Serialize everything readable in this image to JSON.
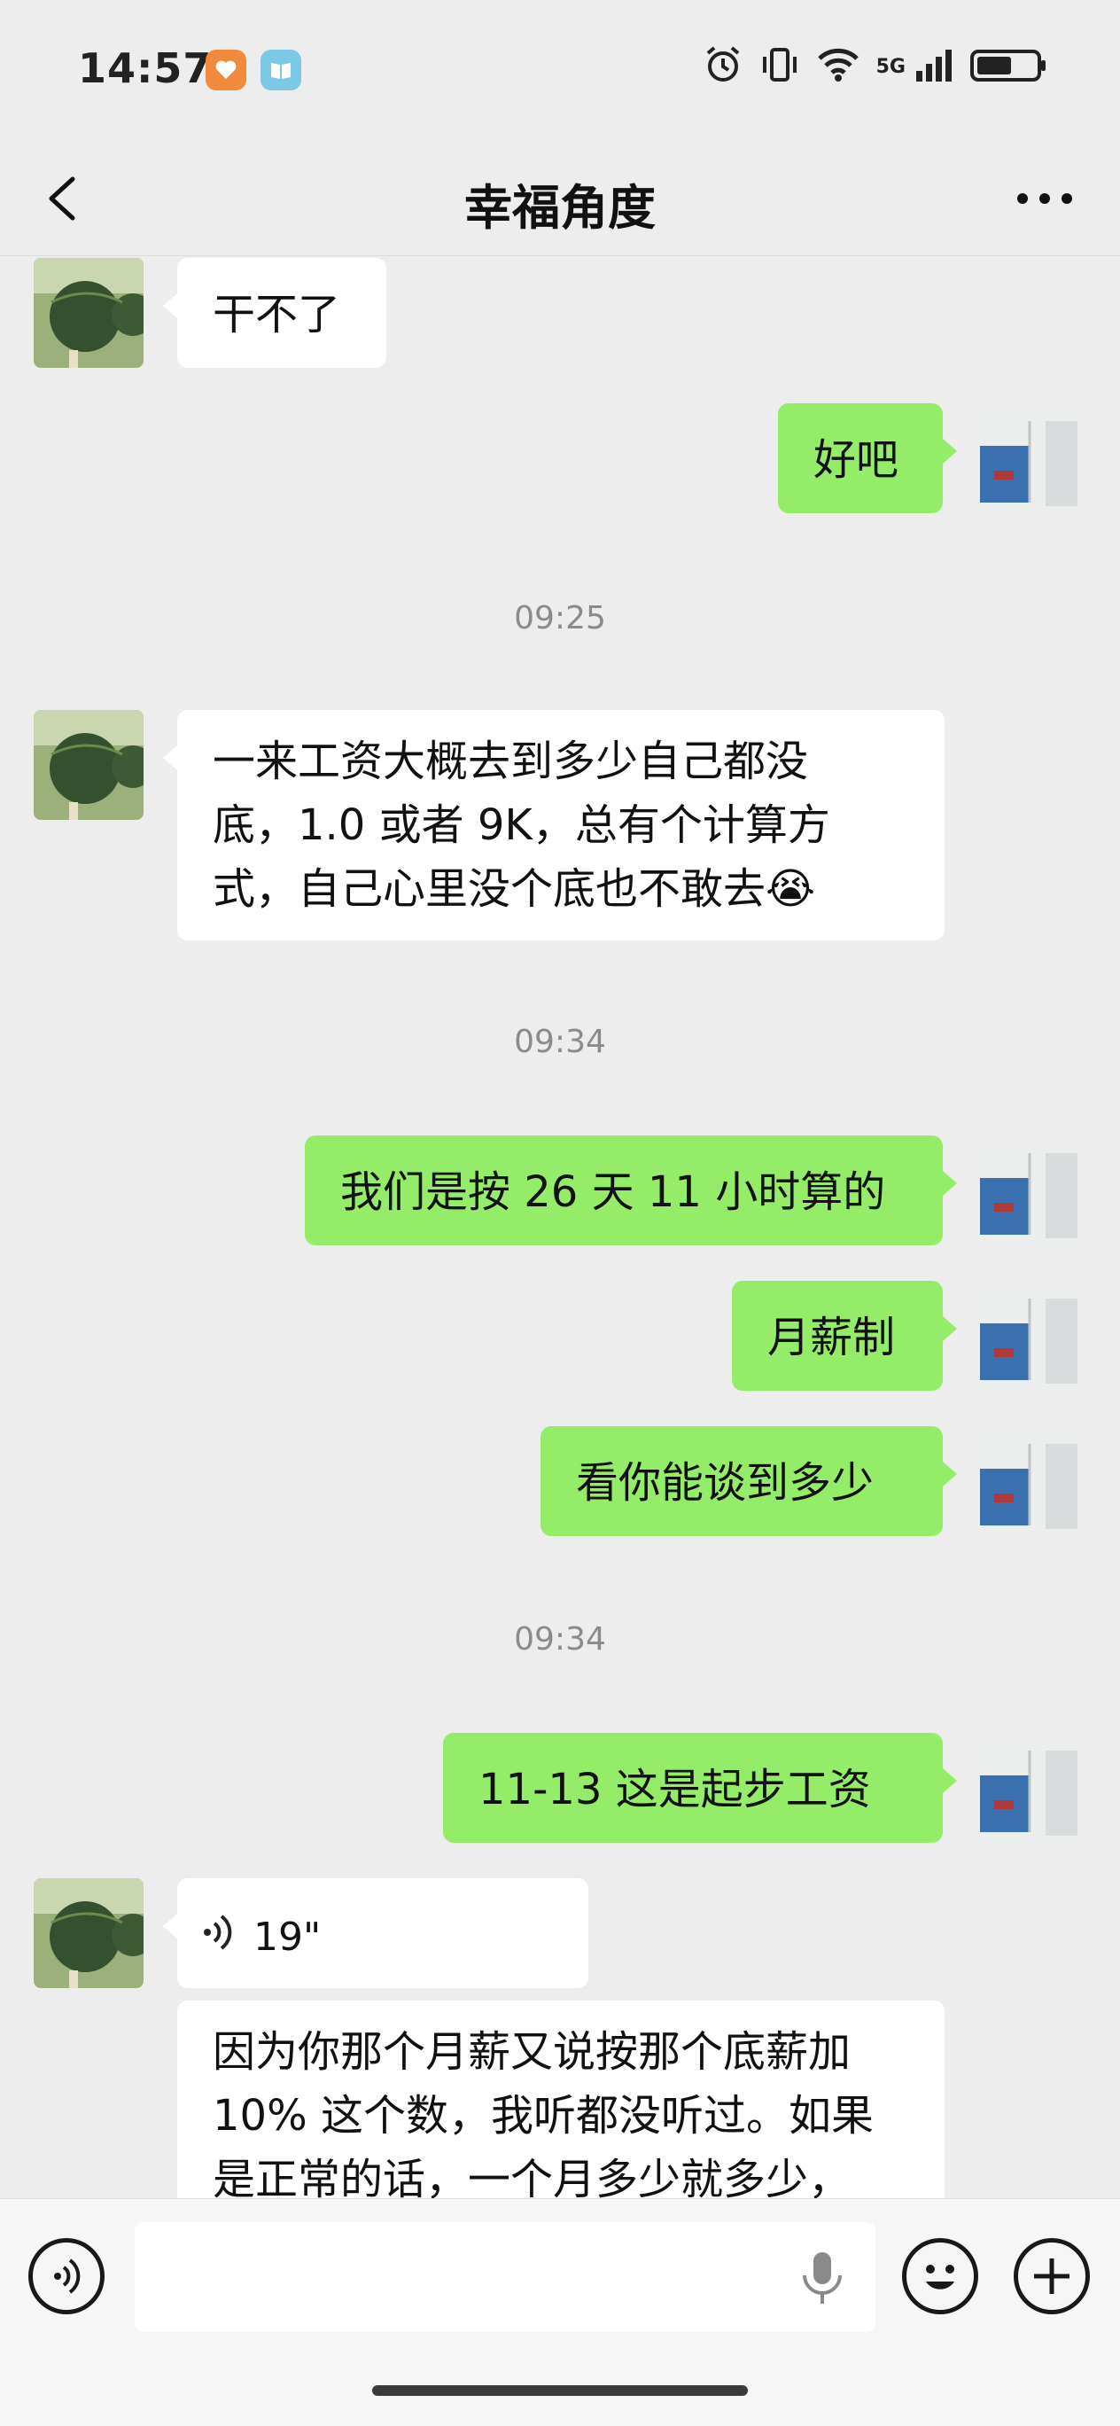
{
  "status_bar": {
    "time": "14:57",
    "network": "5G",
    "icons": [
      "heart-app-icon",
      "book-app-icon",
      "alarm-icon",
      "vibrate-icon",
      "wifi-icon",
      "signal-icon",
      "battery-icon"
    ]
  },
  "header": {
    "title": "幸福角度",
    "back_icon": "chevron-left-icon",
    "more_icon": "more-horizontal-icon"
  },
  "messages": [
    {
      "type": "text",
      "sender": "other",
      "text": "干不了"
    },
    {
      "type": "text",
      "sender": "me",
      "text": "好吧"
    },
    {
      "type": "timestamp",
      "text": "09:25"
    },
    {
      "type": "text",
      "sender": "other",
      "lines": [
        "一来工资大概去到多少自己都没",
        "底，1.0 或者 9K，总有个计算方",
        "式，自己心里没个底也不敢去😭"
      ]
    },
    {
      "type": "timestamp",
      "text": "09:34"
    },
    {
      "type": "text",
      "sender": "me",
      "text": "我们是按 26 天 11 小时算的"
    },
    {
      "type": "text",
      "sender": "me",
      "text": "月薪制"
    },
    {
      "type": "text",
      "sender": "me",
      "text": "看你能谈到多少"
    },
    {
      "type": "timestamp",
      "text": "09:34"
    },
    {
      "type": "text",
      "sender": "me",
      "text": "11-13 这是起步工资"
    },
    {
      "type": "voice",
      "sender": "other",
      "duration": "19\""
    },
    {
      "type": "text",
      "sender": "other",
      "lines": [
        "因为你那个月薪又说按那个底薪加",
        "10% 这个数，我听都没听过。如果",
        "是正常的话，一个月多少就多少，"
      ]
    }
  ],
  "input_bar": {
    "voice_toggle_icon": "voice-input-icon",
    "placeholder": "",
    "mic_icon": "microphone-icon",
    "emoji_icon": "emoji-icon",
    "plus_icon": "plus-icon"
  },
  "colors": {
    "background": "#ededed",
    "outgoing_bubble": "#95ec69",
    "incoming_bubble": "#ffffff",
    "timestamp": "#8a8a8a"
  }
}
